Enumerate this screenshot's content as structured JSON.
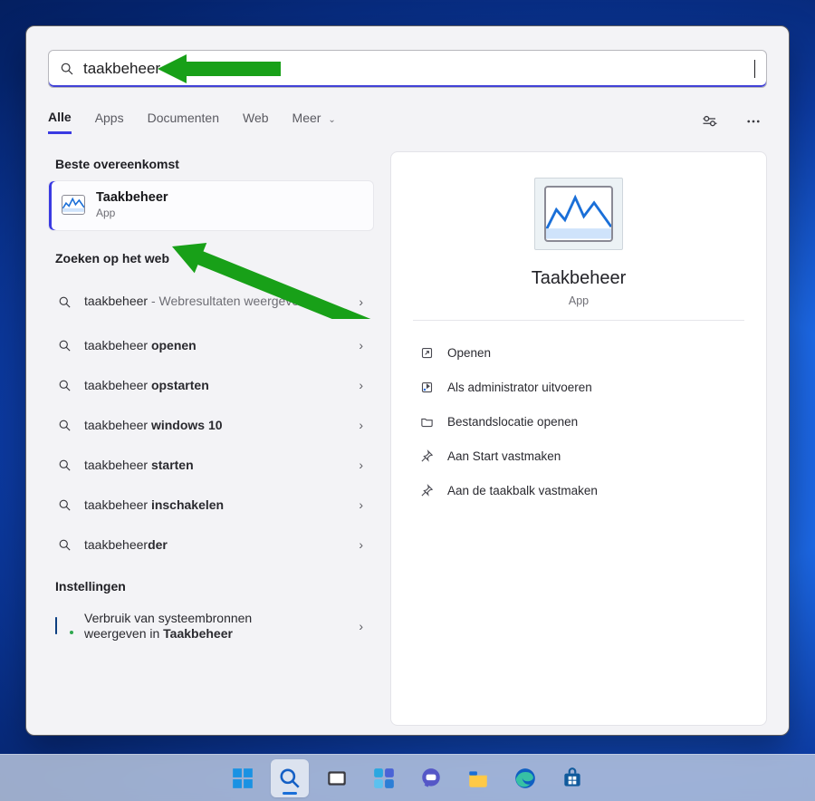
{
  "search": {
    "value": "taakbeheer"
  },
  "tabs": {
    "items": [
      "Alle",
      "Apps",
      "Documenten",
      "Web",
      "Meer"
    ],
    "moreHasChevron": true
  },
  "sections": {
    "bestMatch": "Beste overeenkomst",
    "web": "Zoeken op het web",
    "settings": "Instellingen"
  },
  "bestMatch": {
    "title": "Taakbeheer",
    "subtitle": "App"
  },
  "webResults": [
    {
      "prefix": "taakbeheer",
      "suffix": " - Webresultaten weergeven",
      "suffixLight": true,
      "twoLine": true
    },
    {
      "prefix": "taakbeheer ",
      "bold": "openen"
    },
    {
      "prefix": "taakbeheer ",
      "bold": "opstarten"
    },
    {
      "prefix": "taakbeheer ",
      "bold": "windows 10"
    },
    {
      "prefix": "taakbeheer ",
      "bold": "starten"
    },
    {
      "prefix": "taakbeheer ",
      "bold": "inschakelen"
    },
    {
      "prefix": "taakbeheer",
      "bold": "der"
    }
  ],
  "settingsItem": {
    "line1": "Verbruik van systeembronnen",
    "line2pre": "weergeven in ",
    "line2bold": "Taakbeheer"
  },
  "preview": {
    "title": "Taakbeheer",
    "subtitle": "App"
  },
  "actions": [
    {
      "icon": "open",
      "label": "Openen"
    },
    {
      "icon": "admin",
      "label": "Als administrator uitvoeren"
    },
    {
      "icon": "folder",
      "label": "Bestandslocatie openen"
    },
    {
      "icon": "pin",
      "label": "Aan Start vastmaken"
    },
    {
      "icon": "pin",
      "label": "Aan de taakbalk vastmaken"
    }
  ],
  "taskbar": {
    "items": [
      {
        "name": "start"
      },
      {
        "name": "search",
        "active": true
      },
      {
        "name": "task-view"
      },
      {
        "name": "widgets"
      },
      {
        "name": "chat"
      },
      {
        "name": "file-explorer"
      },
      {
        "name": "edge"
      },
      {
        "name": "store"
      }
    ]
  }
}
